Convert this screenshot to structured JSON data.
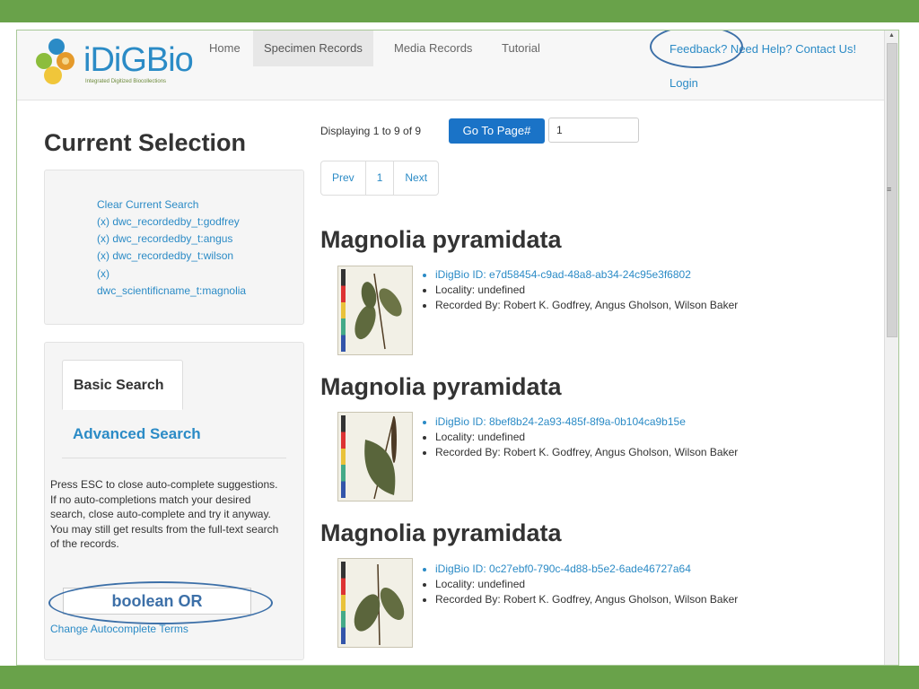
{
  "nav": {
    "logo_text": "iDiGBio",
    "logo_tagline": "Integrated Digitized Biocollections",
    "items": [
      {
        "label": "Home"
      },
      {
        "label": "Specimen Records"
      },
      {
        "label": "Media Records"
      },
      {
        "label": "Tutorial"
      }
    ],
    "feedback_label": "Feedback? Need Help? Contact Us!",
    "login_label": "Login"
  },
  "sidebar": {
    "title": "Current Selection",
    "selection_links": [
      "Clear Current Search",
      "(x) dwc_recordedby_t:godfrey",
      "(x) dwc_recordedby_t:angus",
      "(x) dwc_recordedby_t:wilson",
      "(x)",
      "dwc_scientificname_t:magnolia"
    ],
    "tabs": {
      "basic": "Basic Search",
      "advanced": "Advanced Search"
    },
    "help_text": "Press ESC to close auto-complete suggestions. If no auto-completions match your desired search, close auto-complete and try it anyway. You may still get results from the full-text search of the records.",
    "boolean_box": "boolean OR",
    "change_terms_link": "Change Autocomplete Terms"
  },
  "results": {
    "displaying_text": "Displaying 1 to 9 of 9",
    "goto_button": "Go To Page#",
    "page_input_value": "1",
    "pager": {
      "prev": "Prev",
      "page": "1",
      "next": "Next"
    },
    "records": [
      {
        "title": "Magnolia pyramidata",
        "idigbio_id": "iDigBio ID: e7d58454-c9ad-48a8-ab34-24c95e3f6802",
        "locality": "Locality: undefined",
        "recorded_by": "Recorded By: Robert K. Godfrey, Angus Gholson, Wilson Baker"
      },
      {
        "title": "Magnolia pyramidata",
        "idigbio_id": "iDigBio ID: 8bef8b24-2a93-485f-8f9a-0b104ca9b15e",
        "locality": "Locality: undefined",
        "recorded_by": "Recorded By: Robert K. Godfrey, Angus Gholson, Wilson Baker"
      },
      {
        "title": "Magnolia pyramidata",
        "idigbio_id": "iDigBio ID: 0c27ebf0-790c-4d88-b5e2-6ade46727a64",
        "locality": "Locality: undefined",
        "recorded_by": "Recorded By: Robert K. Godfrey, Angus Gholson, Wilson Baker"
      }
    ]
  },
  "colors": {
    "slide_green": "#69a24a",
    "link_blue": "#2b8bc6",
    "button_blue": "#1a73c7",
    "callout_blue": "#3d70a8"
  },
  "icons": {
    "logo": "idigbio-logo-icon",
    "scroll_up": "scroll-up-arrow-icon",
    "scroll_grip": "scroll-grip-icon"
  }
}
